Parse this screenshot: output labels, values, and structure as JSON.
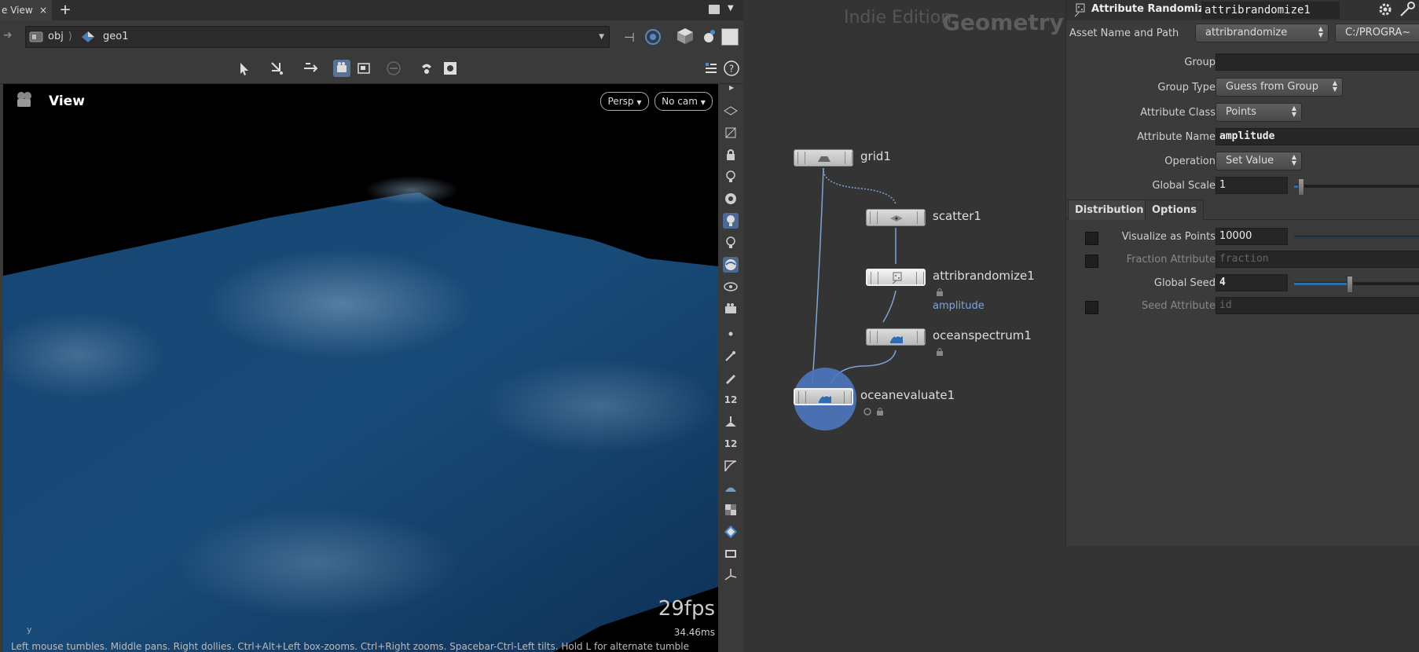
{
  "tabbar": {
    "tab_label": "e View",
    "close_glyph": "×",
    "add_glyph": "+"
  },
  "pathbar": {
    "segments": [
      "obj",
      "geo1"
    ]
  },
  "viewer": {
    "title": "View",
    "persp_label": "Persp",
    "camera_label": "No cam",
    "fps": "29fps",
    "frame_time": "34.46ms",
    "axis_label": "y",
    "status_text": "Left mouse tumbles. Middle pans. Right dollies. Ctrl+Alt+Left box-zooms. Ctrl+Right zooms. Spacebar-Ctrl-Left tilts. Hold L for alternate tumble"
  },
  "network": {
    "watermark_edition": "Indie Edition",
    "watermark_context": "Geometry",
    "nodes": [
      {
        "name": "grid1"
      },
      {
        "name": "scatter1"
      },
      {
        "name": "attribrandomize1",
        "sub_label": "amplitude"
      },
      {
        "name": "oceanspectrum1"
      },
      {
        "name": "oceanevaluate1"
      }
    ]
  },
  "params": {
    "node_type": "Attribute Randomize",
    "node_name": "attribrandomize1",
    "asset_label": "Asset Name and Path",
    "asset_value": "attribrandomize",
    "asset_path": "C:/PROGRA~",
    "rows": {
      "group": {
        "label": "Group",
        "value": ""
      },
      "group_type": {
        "label": "Group Type",
        "value": "Guess from Group"
      },
      "attribute_class": {
        "label": "Attribute Class",
        "value": "Points"
      },
      "attribute_name": {
        "label": "Attribute Name",
        "value": "amplitude"
      },
      "operation": {
        "label": "Operation",
        "value": "Set Value"
      },
      "global_scale": {
        "label": "Global Scale",
        "value": "1",
        "slider_fraction": 0.05
      }
    },
    "tabs": [
      "Distribution",
      "Options"
    ],
    "active_tab": "Options",
    "options": {
      "visualize_as_points": {
        "label": "Visualize as Points",
        "value": "10000",
        "checked": false
      },
      "fraction_attribute": {
        "label": "Fraction Attribute",
        "value": "fraction",
        "checked": false
      },
      "global_seed": {
        "label": "Global Seed",
        "value": "4",
        "slider_fraction": 0.43
      },
      "seed_attribute": {
        "label": "Seed Attribute",
        "value": "id",
        "checked": false
      }
    }
  },
  "colors": {
    "selection": "#5a7394",
    "wire": "#7fa5d8",
    "ocean": "#1b4d7a",
    "slider": "#2d6fa8"
  }
}
